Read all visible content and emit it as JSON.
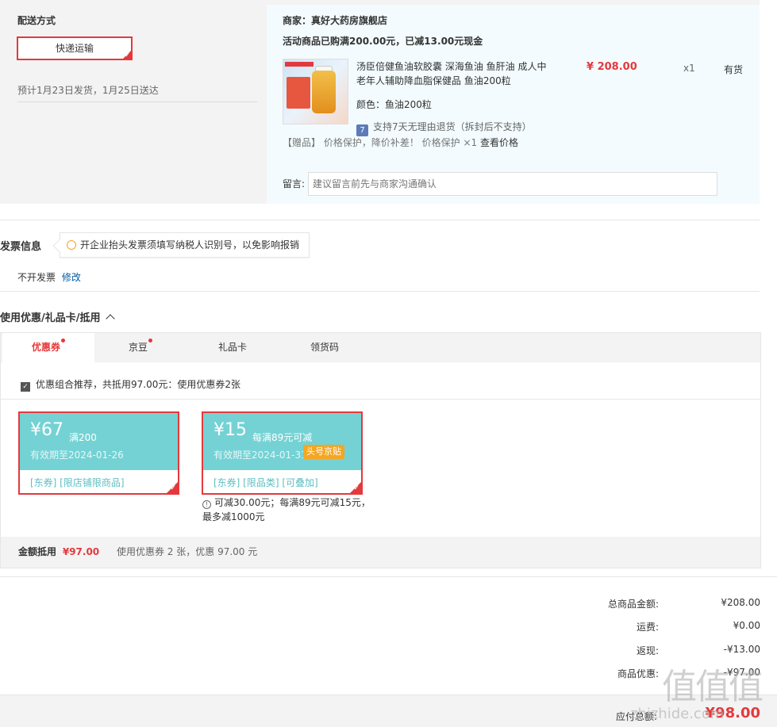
{
  "shipping": {
    "title": "配送方式",
    "method": "快递运输",
    "estimate": "预计1月23日发货，1月25日送达"
  },
  "product": {
    "shop": "商家：真好大药房旗舰店",
    "promo": "活动商品已购满200.00元，已减13.00元现金",
    "title": "汤臣倍健鱼油软胶囊 深海鱼油 鱼肝油 成人中老年人辅助降血脂保健品 鱼油200粒",
    "price": "¥ 208.00",
    "qty": "x1",
    "stock": "有货",
    "color": "颜色：鱼油200粒",
    "return_icon": "7",
    "return_text": "支持7天无理由退货（拆封后不支持）",
    "gift_text": "【赠品】  价格保护，降价补差！ 价格保护 ×1",
    "view_price": "查看价格",
    "message_label": "留言:",
    "message_placeholder": "建议留言前先与商家沟通确认"
  },
  "invoice": {
    "title": "发票信息",
    "tip": "开企业抬头发票须填写纳税人识别号，以免影响报销",
    "status": "不开发票",
    "edit": "修改"
  },
  "coupons": {
    "title": "使用优惠/礼品卡/抵用",
    "tabs": [
      {
        "label": "优惠券",
        "dot": true
      },
      {
        "label": "京豆",
        "dot": true
      },
      {
        "label": "礼品卡",
        "dot": false
      },
      {
        "label": "领货码",
        "dot": false
      }
    ],
    "combo": "优惠组合推荐，共抵用97.00元：使用优惠券2张",
    "items": [
      {
        "amount": "¥67",
        "condition": "满200",
        "valid": "有效期至2024-01-26",
        "badge": "",
        "tags": "[东券]   [限店铺限商品]"
      },
      {
        "amount": "¥15",
        "condition": "每满89元可减",
        "valid": "有效期至2024-01-31",
        "badge": "头号京贴",
        "tags": "[东券]   [限品类]   [可叠加]"
      }
    ],
    "note": "可减30.00元；每满89元可减15元，最多减1000元",
    "summary_label": "金额抵用",
    "summary_amount": "¥97.00",
    "summary_desc": "使用优惠券 2 张，优惠 97.00 元"
  },
  "totals": {
    "goods_label": "总商品金额:",
    "goods_value": "¥208.00",
    "freight_label": "运费:",
    "freight_value": "¥0.00",
    "rebate_label": "返现:",
    "rebate_value": "-¥13.00",
    "discount_label": "商品优惠:",
    "discount_value": "-¥97.00",
    "pay_label": "应付总额:",
    "pay_value": "¥98.00"
  },
  "watermark": {
    "glyphs": "值值值",
    "text": "zhizhide.com"
  },
  "colors": {
    "accent": "#e4393c",
    "coupon_bg": "#74d2d4",
    "link": "#005aa0",
    "badge": "#f5a623"
  }
}
